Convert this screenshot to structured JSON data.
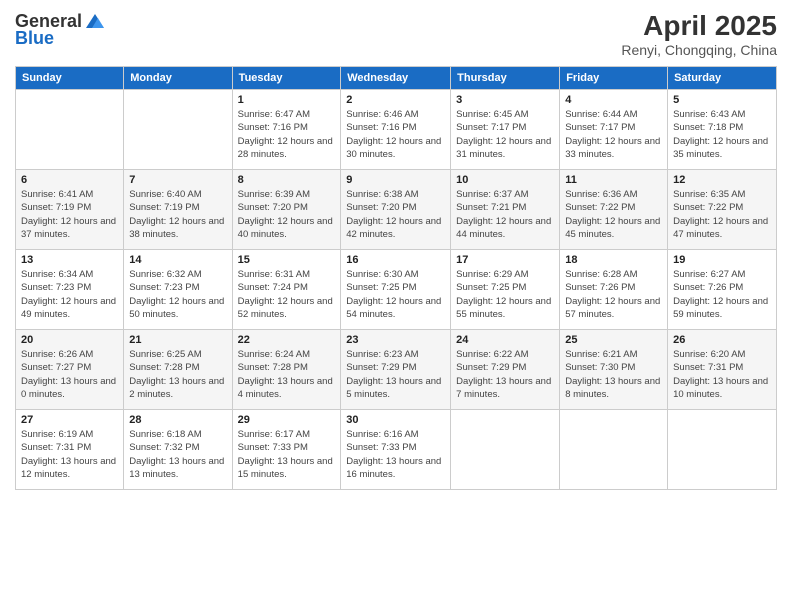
{
  "logo": {
    "general": "General",
    "blue": "Blue"
  },
  "title": "April 2025",
  "subtitle": "Renyi, Chongqing, China",
  "weekdays": [
    "Sunday",
    "Monday",
    "Tuesday",
    "Wednesday",
    "Thursday",
    "Friday",
    "Saturday"
  ],
  "weeks": [
    [
      {
        "day": "",
        "info": ""
      },
      {
        "day": "",
        "info": ""
      },
      {
        "day": "1",
        "info": "Sunrise: 6:47 AM\nSunset: 7:16 PM\nDaylight: 12 hours and 28 minutes."
      },
      {
        "day": "2",
        "info": "Sunrise: 6:46 AM\nSunset: 7:16 PM\nDaylight: 12 hours and 30 minutes."
      },
      {
        "day": "3",
        "info": "Sunrise: 6:45 AM\nSunset: 7:17 PM\nDaylight: 12 hours and 31 minutes."
      },
      {
        "day": "4",
        "info": "Sunrise: 6:44 AM\nSunset: 7:17 PM\nDaylight: 12 hours and 33 minutes."
      },
      {
        "day": "5",
        "info": "Sunrise: 6:43 AM\nSunset: 7:18 PM\nDaylight: 12 hours and 35 minutes."
      }
    ],
    [
      {
        "day": "6",
        "info": "Sunrise: 6:41 AM\nSunset: 7:19 PM\nDaylight: 12 hours and 37 minutes."
      },
      {
        "day": "7",
        "info": "Sunrise: 6:40 AM\nSunset: 7:19 PM\nDaylight: 12 hours and 38 minutes."
      },
      {
        "day": "8",
        "info": "Sunrise: 6:39 AM\nSunset: 7:20 PM\nDaylight: 12 hours and 40 minutes."
      },
      {
        "day": "9",
        "info": "Sunrise: 6:38 AM\nSunset: 7:20 PM\nDaylight: 12 hours and 42 minutes."
      },
      {
        "day": "10",
        "info": "Sunrise: 6:37 AM\nSunset: 7:21 PM\nDaylight: 12 hours and 44 minutes."
      },
      {
        "day": "11",
        "info": "Sunrise: 6:36 AM\nSunset: 7:22 PM\nDaylight: 12 hours and 45 minutes."
      },
      {
        "day": "12",
        "info": "Sunrise: 6:35 AM\nSunset: 7:22 PM\nDaylight: 12 hours and 47 minutes."
      }
    ],
    [
      {
        "day": "13",
        "info": "Sunrise: 6:34 AM\nSunset: 7:23 PM\nDaylight: 12 hours and 49 minutes."
      },
      {
        "day": "14",
        "info": "Sunrise: 6:32 AM\nSunset: 7:23 PM\nDaylight: 12 hours and 50 minutes."
      },
      {
        "day": "15",
        "info": "Sunrise: 6:31 AM\nSunset: 7:24 PM\nDaylight: 12 hours and 52 minutes."
      },
      {
        "day": "16",
        "info": "Sunrise: 6:30 AM\nSunset: 7:25 PM\nDaylight: 12 hours and 54 minutes."
      },
      {
        "day": "17",
        "info": "Sunrise: 6:29 AM\nSunset: 7:25 PM\nDaylight: 12 hours and 55 minutes."
      },
      {
        "day": "18",
        "info": "Sunrise: 6:28 AM\nSunset: 7:26 PM\nDaylight: 12 hours and 57 minutes."
      },
      {
        "day": "19",
        "info": "Sunrise: 6:27 AM\nSunset: 7:26 PM\nDaylight: 12 hours and 59 minutes."
      }
    ],
    [
      {
        "day": "20",
        "info": "Sunrise: 6:26 AM\nSunset: 7:27 PM\nDaylight: 13 hours and 0 minutes."
      },
      {
        "day": "21",
        "info": "Sunrise: 6:25 AM\nSunset: 7:28 PM\nDaylight: 13 hours and 2 minutes."
      },
      {
        "day": "22",
        "info": "Sunrise: 6:24 AM\nSunset: 7:28 PM\nDaylight: 13 hours and 4 minutes."
      },
      {
        "day": "23",
        "info": "Sunrise: 6:23 AM\nSunset: 7:29 PM\nDaylight: 13 hours and 5 minutes."
      },
      {
        "day": "24",
        "info": "Sunrise: 6:22 AM\nSunset: 7:29 PM\nDaylight: 13 hours and 7 minutes."
      },
      {
        "day": "25",
        "info": "Sunrise: 6:21 AM\nSunset: 7:30 PM\nDaylight: 13 hours and 8 minutes."
      },
      {
        "day": "26",
        "info": "Sunrise: 6:20 AM\nSunset: 7:31 PM\nDaylight: 13 hours and 10 minutes."
      }
    ],
    [
      {
        "day": "27",
        "info": "Sunrise: 6:19 AM\nSunset: 7:31 PM\nDaylight: 13 hours and 12 minutes."
      },
      {
        "day": "28",
        "info": "Sunrise: 6:18 AM\nSunset: 7:32 PM\nDaylight: 13 hours and 13 minutes."
      },
      {
        "day": "29",
        "info": "Sunrise: 6:17 AM\nSunset: 7:33 PM\nDaylight: 13 hours and 15 minutes."
      },
      {
        "day": "30",
        "info": "Sunrise: 6:16 AM\nSunset: 7:33 PM\nDaylight: 13 hours and 16 minutes."
      },
      {
        "day": "",
        "info": ""
      },
      {
        "day": "",
        "info": ""
      },
      {
        "day": "",
        "info": ""
      }
    ]
  ]
}
